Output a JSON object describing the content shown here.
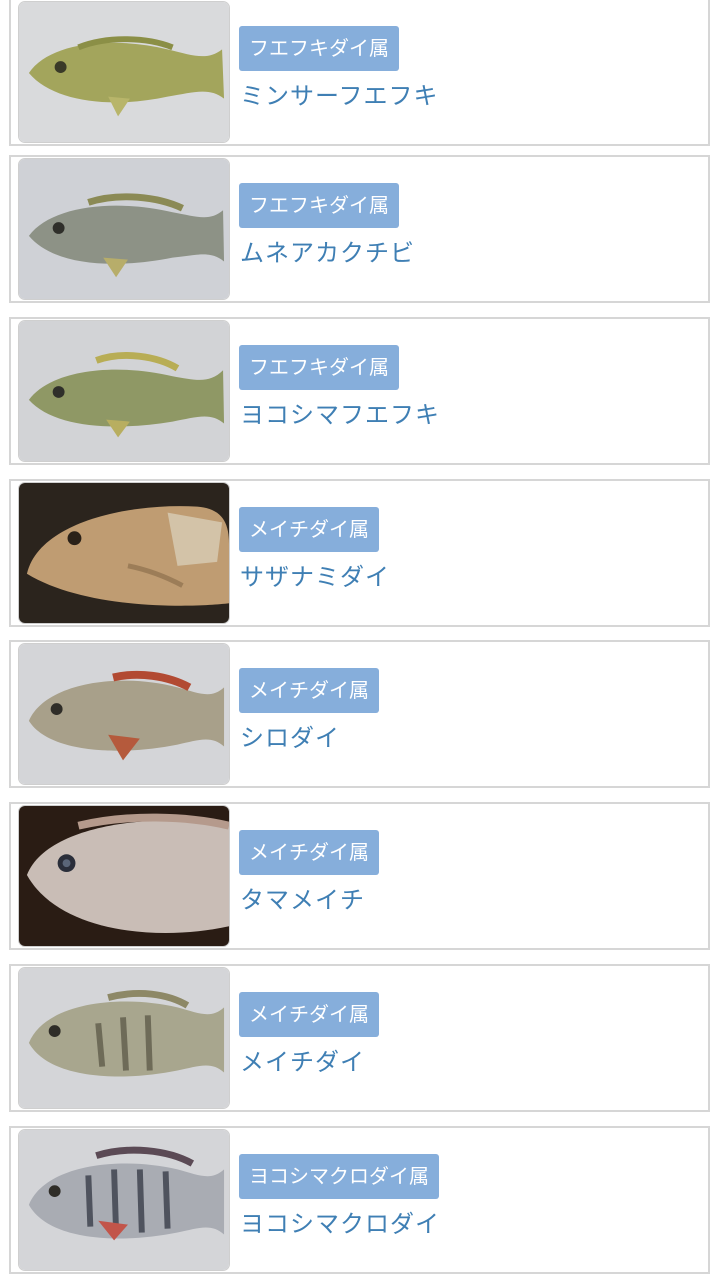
{
  "items": [
    {
      "genus": "フエフキダイ属",
      "name": "ミンサーフエフキ",
      "photo": "fish-photo-greenish-emperor"
    },
    {
      "genus": "フエフキダイ属",
      "name": "ムネアカクチビ",
      "photo": "fish-photo-grey-emperor"
    },
    {
      "genus": "フエフキダイ属",
      "name": "ヨコシマフエフキ",
      "photo": "fish-photo-olive-emperor"
    },
    {
      "genus": "メイチダイ属",
      "name": "サザナミダイ",
      "photo": "fish-photo-tan-seabream"
    },
    {
      "genus": "メイチダイ属",
      "name": "シロダイ",
      "photo": "fish-photo-silver-seabream"
    },
    {
      "genus": "メイチダイ属",
      "name": "タマメイチ",
      "photo": "fish-photo-pale-seabream"
    },
    {
      "genus": "メイチダイ属",
      "name": "メイチダイ",
      "photo": "fish-photo-barred-seabream"
    },
    {
      "genus": "ヨコシマクロダイ属",
      "name": "ヨコシマクロダイ",
      "photo": "fish-photo-striped-seabream"
    }
  ],
  "colors": {
    "badge_bg": "#86aedb",
    "name_text": "#3f7fb4",
    "card_border": "#d6d6d6"
  }
}
